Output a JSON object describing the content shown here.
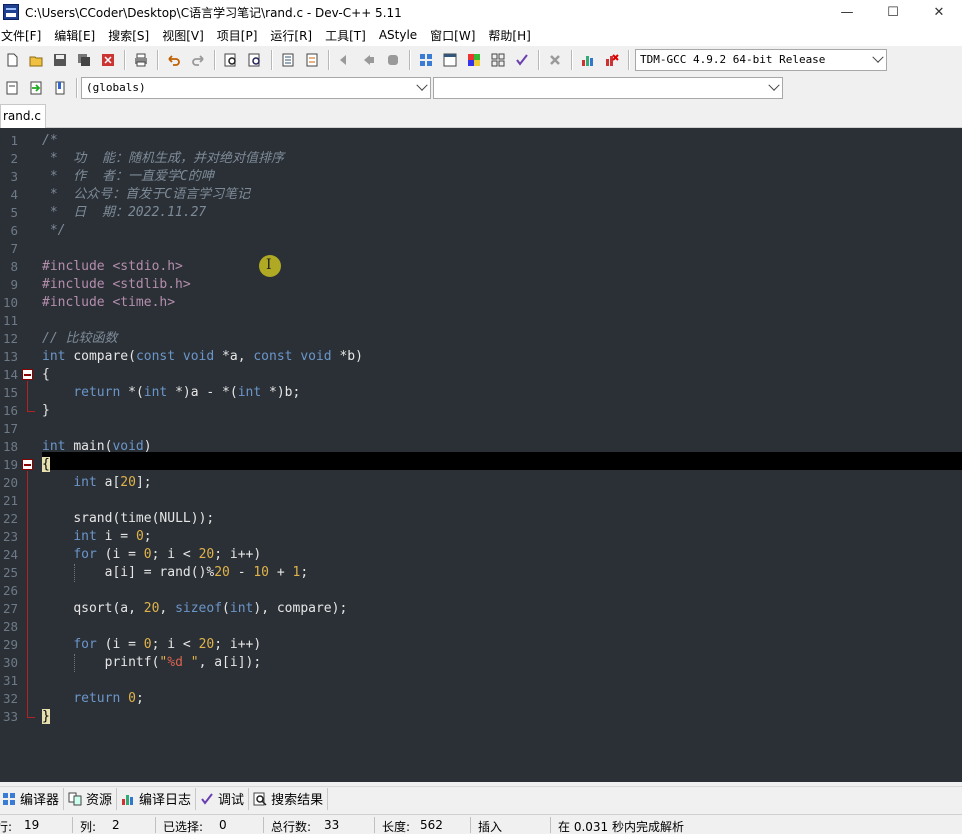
{
  "window": {
    "title": "C:\\Users\\CCoder\\Desktop\\C语言学习笔记\\rand.c - Dev-C++ 5.11",
    "minimize": "—",
    "maximize": "☐",
    "close": "✕"
  },
  "menu": [
    "文件[F]",
    "编辑[E]",
    "搜索[S]",
    "视图[V]",
    "项目[P]",
    "运行[R]",
    "工具[T]",
    "AStyle",
    "窗口[W]",
    "帮助[H]"
  ],
  "toolbar": {
    "compiler_select": "TDM-GCC 4.9.2 64-bit Release",
    "scope_select": "(globals)",
    "member_select": ""
  },
  "tabs": [
    "rand.c"
  ],
  "editor": {
    "current_line": 19,
    "lines": [
      "/*",
      " *  功  能：随机生成，并对绝对值排序",
      " *  作  者：一直爱学C的呻",
      " *  公众号：首发于C语言学习笔记",
      " *  日  期：2022.11.27",
      " */",
      "",
      "#include <stdio.h>",
      "#include <stdlib.h>",
      "#include <time.h>",
      "",
      "// 比较函数",
      "int compare(const void *a, const void *b)",
      "{",
      "    return *(int *)a - *(int *)b;",
      "}",
      "",
      "int main(void)",
      "{",
      "    int a[20];",
      "",
      "    srand(time(NULL));",
      "    int i = 0;",
      "    for (i = 0; i < 20; i++)",
      "        a[i] = rand()%20 - 10 + 1;",
      "",
      "    qsort(a, 20, sizeof(int), compare);",
      "",
      "    for (i = 0; i < 20; i++)",
      "        printf(\"%d \", a[i]);",
      "",
      "    return 0;",
      "}"
    ]
  },
  "bottom_tabs": [
    {
      "label": "编译器",
      "icon": "grid-icon"
    },
    {
      "label": "资源",
      "icon": "resources-icon"
    },
    {
      "label": "编译日志",
      "icon": "bar-chart-icon"
    },
    {
      "label": "调试",
      "icon": "check-icon"
    },
    {
      "label": "搜索结果",
      "icon": "search-icon"
    }
  ],
  "status": {
    "row_label": "行:",
    "row_value": "19",
    "col_label": "列:",
    "col_value": "2",
    "selected_label": "已选择:",
    "selected_value": "0",
    "total_label": "总行数:",
    "total_value": "33",
    "length_label": "长度:",
    "length_value": "562",
    "mode": "插入",
    "parse_msg": "在 0.031 秒内完成解析"
  }
}
